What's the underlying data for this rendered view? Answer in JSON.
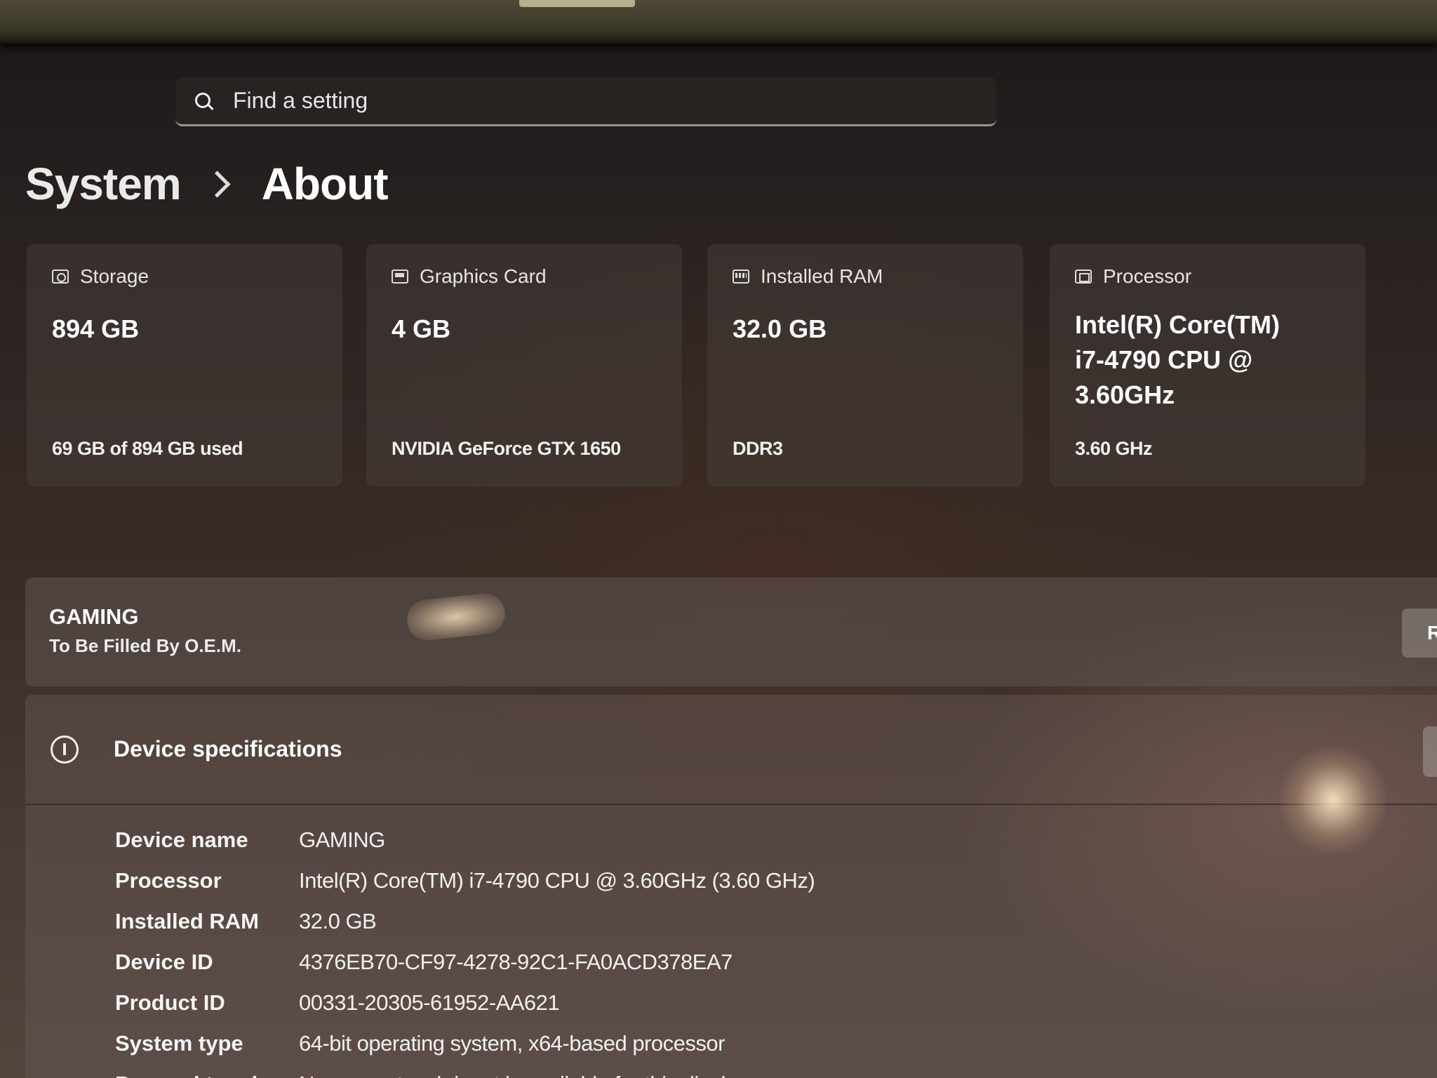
{
  "search": {
    "placeholder": "Find a setting"
  },
  "breadcrumb": {
    "parent": "System",
    "current": "About"
  },
  "cards": [
    {
      "title": "Storage",
      "icon": "storage-icon",
      "value": "894 GB",
      "foot": "69 GB of 894 GB used"
    },
    {
      "title": "Graphics Card",
      "icon": "graphics-card-icon",
      "value": "4 GB",
      "foot": "NVIDIA GeForce GTX 1650"
    },
    {
      "title": "Installed RAM",
      "icon": "ram-icon",
      "value": "32.0 GB",
      "foot": "DDR3"
    },
    {
      "title": "Processor",
      "icon": "processor-icon",
      "value": "Intel(R) Core(TM) i7-4790 CPU @ 3.60GHz",
      "foot": "3.60 GHz"
    }
  ],
  "device": {
    "name": "GAMING",
    "oem": "To Be Filled By O.E.M.",
    "rename_label": "R"
  },
  "specs": {
    "title": "Device specifications",
    "rows": [
      {
        "label": "Device name",
        "value": "GAMING"
      },
      {
        "label": "Processor",
        "value": "Intel(R) Core(TM) i7-4790 CPU @ 3.60GHz (3.60 GHz)"
      },
      {
        "label": "Installed RAM",
        "value": "32.0 GB"
      },
      {
        "label": "Device ID",
        "value": "4376EB70-CF97-4278-92C1-FA0ACD378EA7"
      },
      {
        "label": "Product ID",
        "value": "00331-20305-61952-AA621"
      },
      {
        "label": "System type",
        "value": "64-bit operating system, x64-based processor"
      },
      {
        "label": "Pen and touch",
        "value": "No pen or touch input is available for this display"
      }
    ]
  }
}
